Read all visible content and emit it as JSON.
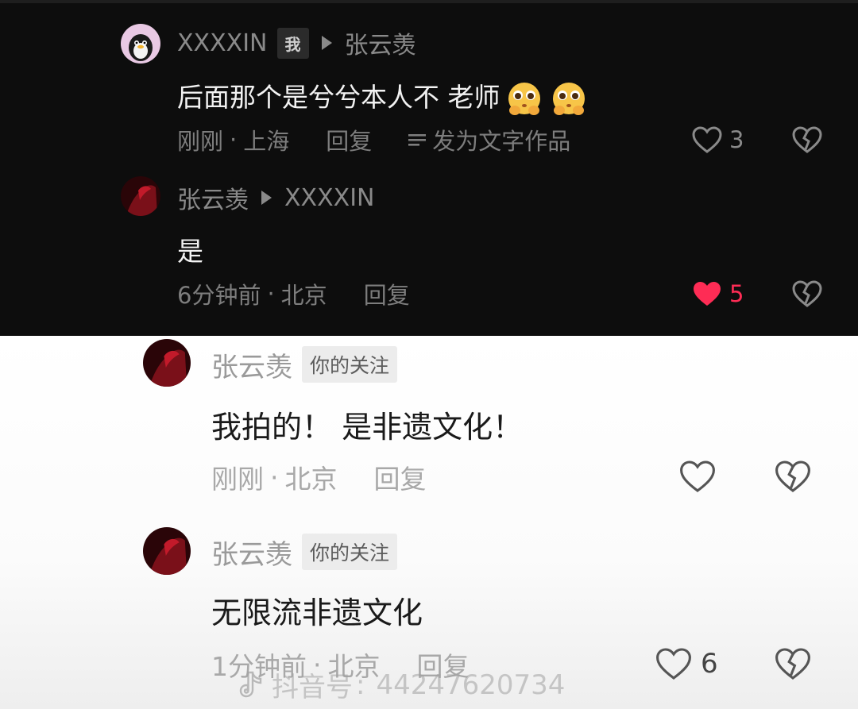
{
  "comments": [
    {
      "user": "XXXXIN",
      "me_tag": "我",
      "reply_to": "张云羡",
      "text": "后面那个是兮兮本人不 老师",
      "emojis": [
        "pleading-face",
        "pleading-face"
      ],
      "time": "刚刚",
      "location": "上海",
      "reply_label": "回复",
      "publish_label": "发为文字作品",
      "likes": "3",
      "liked": false
    },
    {
      "user": "张云羡",
      "reply_to": "XXXXIN",
      "text": "是",
      "time": "6分钟前",
      "location": "北京",
      "reply_label": "回复",
      "likes": "5",
      "liked": true
    },
    {
      "user": "张云羡",
      "follow_tag": "你的关注",
      "text": "我拍的！ 是非遗文化！",
      "time": "刚刚",
      "location": "北京",
      "reply_label": "回复",
      "likes": "",
      "liked": false
    },
    {
      "user": "张云羡",
      "follow_tag": "你的关注",
      "text": "无限流非遗文化",
      "time": "1分钟前",
      "location": "北京",
      "reply_label": "回复",
      "likes": "6",
      "liked": false
    }
  ],
  "dot": "·",
  "watermark": {
    "platform": "抖音号",
    "colon": ":",
    "id": "44247620734"
  },
  "colors": {
    "like_active": "#fe2c55",
    "dark_bg": "#0d0d0d",
    "light_bg": "#ffffff"
  }
}
